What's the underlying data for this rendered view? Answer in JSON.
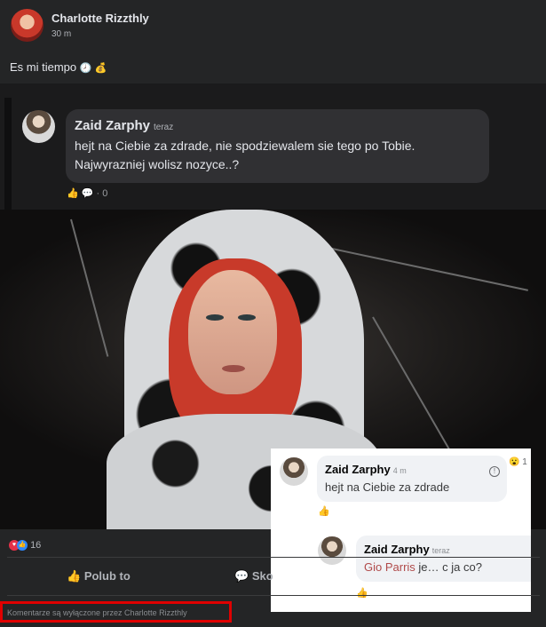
{
  "post": {
    "author": "Charlotte Rizzthly",
    "time": "30 m",
    "status_text": "Es mi tiempo",
    "status_emojis": "🕗 💰"
  },
  "embedded_comment": {
    "name": "Zaid Zarphy",
    "time": "teraz",
    "text": "hejt na Ciebie za zdrade, nie spodziewalem sie tego po Tobie. Najwyrazniej wolisz nozyce..?",
    "actions": "· 0"
  },
  "overlay": {
    "comment1": {
      "name": "Zaid Zarphy",
      "time": "4 m",
      "text": "hejt na Ciebie za zdrade",
      "reaction": "😮 1"
    },
    "comment2": {
      "name": "Zaid Zarphy",
      "time": "teraz",
      "mention": "Gio Parris",
      "text_rest": " je… c ja co?"
    }
  },
  "reactions": {
    "count": "16"
  },
  "actions": {
    "like_label": "Polub to",
    "comment_label": "Sko"
  },
  "footer": {
    "comments_disabled": "Komentarze są wyłączone przez Charlotte Rizzthly"
  }
}
